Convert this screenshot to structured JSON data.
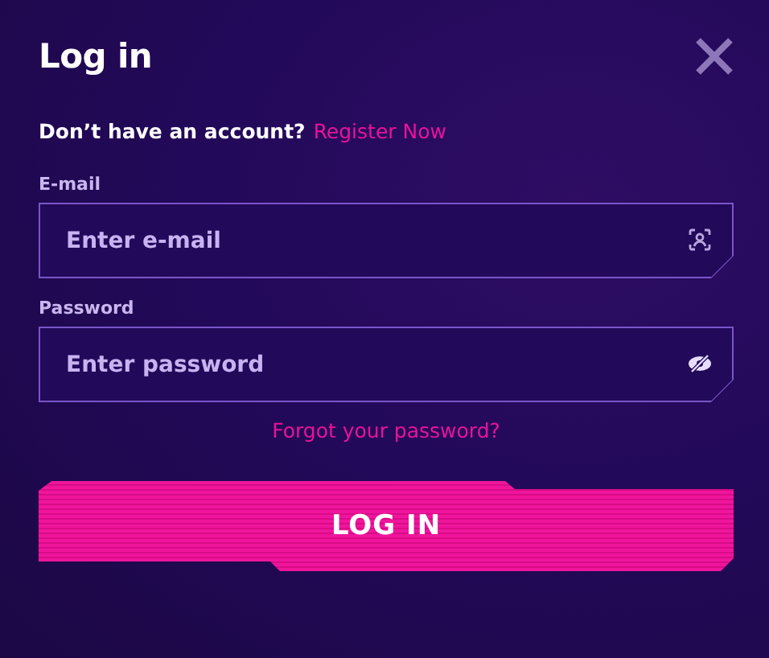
{
  "dialog": {
    "title": "Log in"
  },
  "register": {
    "prompt": "Don’t have an account?",
    "link": "Register Now"
  },
  "fields": [
    {
      "kind": "email",
      "label": "E-mail",
      "placeholder": "Enter e-mail"
    },
    {
      "kind": "password",
      "label": "Password",
      "placeholder": "Enter password"
    }
  ],
  "forgot_link": "Forgot your password?",
  "submit_button": "LOG IN"
}
